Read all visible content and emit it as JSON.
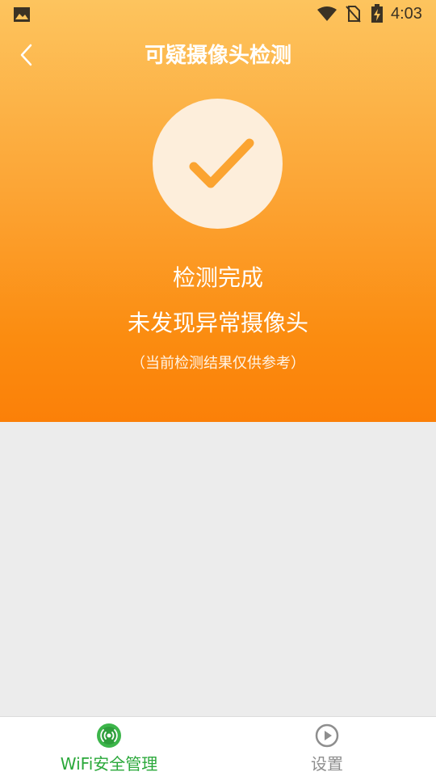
{
  "status_bar": {
    "time": "4:03",
    "icons": [
      "gallery-icon",
      "wifi-icon",
      "no-sim-icon",
      "battery-charging-icon"
    ]
  },
  "header": {
    "title": "可疑摄像头检测",
    "back_icon": "chevron-left-icon"
  },
  "result": {
    "icon": "check-icon",
    "title": "检测完成",
    "subtitle": "未发现异常摄像头",
    "note": "（当前检测结果仅供参考）"
  },
  "bottom_nav": {
    "items": [
      {
        "label": "WiFi安全管理",
        "icon": "wifi-signal-icon",
        "active": true
      },
      {
        "label": "设置",
        "icon": "play-circle-icon",
        "active": false
      }
    ]
  },
  "colors": {
    "gradient_top": "#fdc45e",
    "gradient_bottom": "#fb8008",
    "check": "#fba431",
    "active_tab": "#2aa83a",
    "inactive_tab": "#8e8e8e"
  }
}
